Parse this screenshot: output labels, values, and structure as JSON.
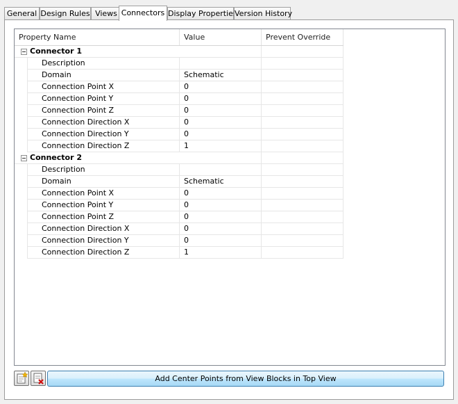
{
  "tabs": [
    {
      "label": "General",
      "active": false
    },
    {
      "label": "Design Rules",
      "active": false
    },
    {
      "label": "Views",
      "active": false
    },
    {
      "label": "Connectors",
      "active": true
    },
    {
      "label": "Display Properties",
      "active": false
    },
    {
      "label": "Version History",
      "active": false
    }
  ],
  "grid": {
    "columns": [
      "Property Name",
      "Value",
      "Prevent Override"
    ],
    "groups": [
      {
        "name": "Connector 1",
        "rows": [
          {
            "name": "Description",
            "value": ""
          },
          {
            "name": "Domain",
            "value": "Schematic"
          },
          {
            "name": "Connection Point X",
            "value": "0"
          },
          {
            "name": "Connection Point Y",
            "value": "0"
          },
          {
            "name": "Connection Point Z",
            "value": "0"
          },
          {
            "name": "Connection Direction X",
            "value": "0"
          },
          {
            "name": "Connection Direction Y",
            "value": "0"
          },
          {
            "name": "Connection Direction Z",
            "value": "1"
          }
        ]
      },
      {
        "name": "Connector 2",
        "rows": [
          {
            "name": "Description",
            "value": ""
          },
          {
            "name": "Domain",
            "value": "Schematic"
          },
          {
            "name": "Connection Point X",
            "value": "0"
          },
          {
            "name": "Connection Point Y",
            "value": "0"
          },
          {
            "name": "Connection Point Z",
            "value": "0"
          },
          {
            "name": "Connection Direction X",
            "value": "0"
          },
          {
            "name": "Connection Direction Y",
            "value": "0"
          },
          {
            "name": "Connection Direction Z",
            "value": "1"
          }
        ]
      }
    ]
  },
  "buttons": {
    "add_icon": "add-connector-icon",
    "delete_icon": "delete-connector-icon",
    "add_center_points": "Add Center Points from View Blocks in Top View"
  },
  "colors": {
    "primary_button_border": "#3c7fb1",
    "primary_button_fill": "#bee6fd"
  }
}
